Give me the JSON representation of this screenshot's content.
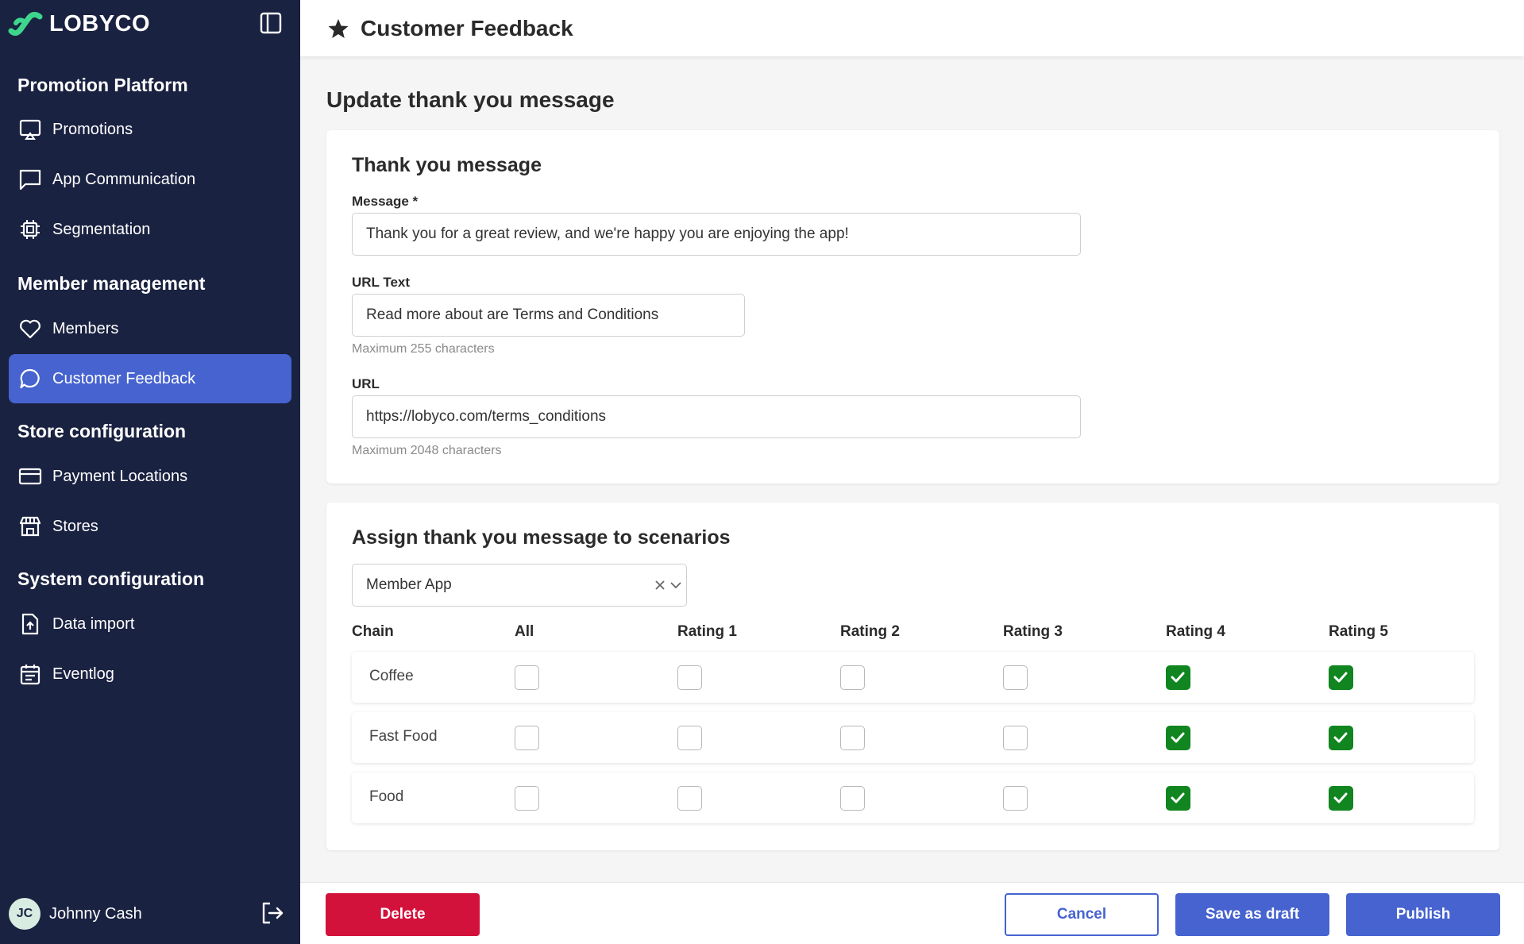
{
  "brand": {
    "name": "LOBYCO",
    "accent": "#4663cf",
    "sidebar_bg": "#1a2241",
    "logo_green": "#3dd68c"
  },
  "sidebar": {
    "sections": [
      {
        "title": "Promotion Platform"
      },
      {
        "title": "Member management"
      },
      {
        "title": "Store configuration"
      },
      {
        "title": "System configuration"
      }
    ],
    "items": [
      {
        "label": "Promotions",
        "icon": "presentation-icon"
      },
      {
        "label": "App Communication",
        "icon": "chat-square-icon"
      },
      {
        "label": "Segmentation",
        "icon": "chip-icon"
      },
      {
        "label": "Members",
        "icon": "heart-icon"
      },
      {
        "label": "Customer Feedback",
        "icon": "chat-bubble-icon",
        "active": true
      },
      {
        "label": "Payment Locations",
        "icon": "credit-card-icon"
      },
      {
        "label": "Stores",
        "icon": "store-icon"
      },
      {
        "label": "Data import",
        "icon": "file-upload-icon"
      },
      {
        "label": "Eventlog",
        "icon": "calendar-icon"
      }
    ],
    "user": {
      "initials": "JC",
      "name": "Johnny Cash"
    }
  },
  "header": {
    "title": "Customer Feedback",
    "icon": "star-icon"
  },
  "page": {
    "heading": "Update thank you message"
  },
  "message_card": {
    "title": "Thank you message",
    "message_label": "Message *",
    "message_value": "Thank you for a great review, and we're happy you are enjoying the app!",
    "url_text_label": "URL Text",
    "url_text_value": "Read more about are Terms and Conditions",
    "url_text_hint": "Maximum 255 characters",
    "url_label": "URL",
    "url_value": "https://lobyco.com/terms_conditions",
    "url_hint": "Maximum 2048 characters"
  },
  "scenario_card": {
    "title": "Assign thank you message to scenarios",
    "select_value": "Member App",
    "columns": [
      "Chain",
      "All",
      "Rating 1",
      "Rating 2",
      "Rating 3",
      "Rating 4",
      "Rating 5"
    ],
    "rows": [
      {
        "chain": "Coffee",
        "checks": [
          false,
          false,
          false,
          false,
          true,
          true
        ]
      },
      {
        "chain": "Fast Food",
        "checks": [
          false,
          false,
          false,
          false,
          true,
          true
        ]
      },
      {
        "chain": "Food",
        "checks": [
          false,
          false,
          false,
          false,
          true,
          true
        ]
      }
    ]
  },
  "footer": {
    "delete_label": "Delete",
    "cancel_label": "Cancel",
    "draft_label": "Save as draft",
    "publish_label": "Publish"
  }
}
